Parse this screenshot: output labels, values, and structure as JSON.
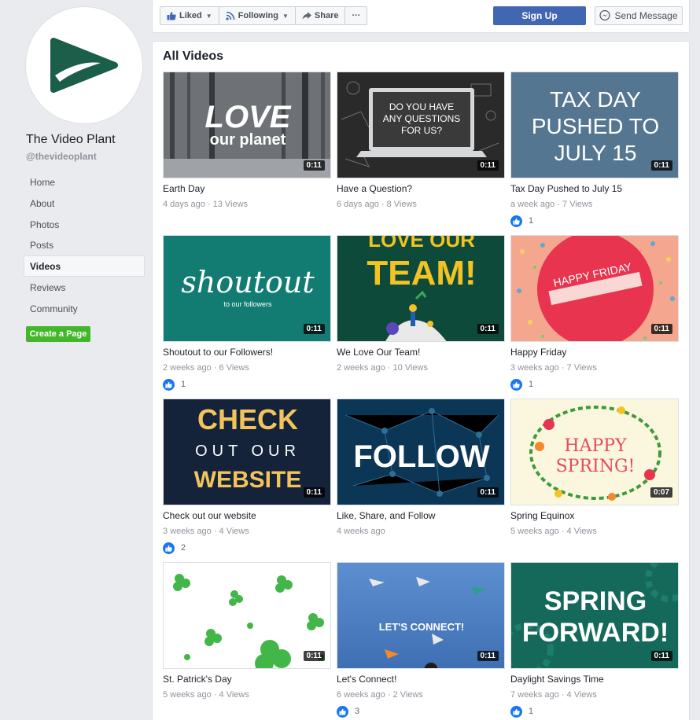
{
  "page": {
    "name": "The Video Plant",
    "handle": "@thevideoplant",
    "colors": {
      "brand_green": "#1b5e4a",
      "fb_blue": "#4267b2",
      "create_green": "#42b72a"
    }
  },
  "sidebar": {
    "items": [
      {
        "label": "Home"
      },
      {
        "label": "About"
      },
      {
        "label": "Photos"
      },
      {
        "label": "Posts"
      },
      {
        "label": "Videos",
        "active": true
      },
      {
        "label": "Reviews"
      },
      {
        "label": "Community"
      }
    ],
    "create_page_label": "Create a Page"
  },
  "action_bar": {
    "liked_label": "Liked",
    "following_label": "Following",
    "share_label": "Share",
    "more_label": "···",
    "signup_label": "Sign Up",
    "send_message_label": "Send Message"
  },
  "videos_section": {
    "title": "All Videos",
    "items": [
      {
        "title": "Earth Day",
        "meta": "4 days ago · 13 Views",
        "duration": "0:11",
        "likes": "",
        "thumb_text": [
          "LOVE",
          "our planet"
        ],
        "thumb_icon": "forest-scene"
      },
      {
        "title": "Have a Question?",
        "meta": "6 days ago · 8 Views",
        "duration": "0:11",
        "likes": "",
        "thumb_text": [
          "DO YOU HAVE",
          "ANY QUESTIONS",
          "FOR US?"
        ],
        "thumb_icon": "laptop-chalkboard"
      },
      {
        "title": "Tax Day Pushed to July 15",
        "meta": "a week ago · 7 Views",
        "duration": "0:11",
        "likes": "1",
        "thumb_text": [
          "TAX DAY",
          "PUSHED TO",
          "JULY 15"
        ],
        "thumb_icon": "none"
      },
      {
        "title": "Shoutout to our Followers!",
        "meta": "2 weeks ago · 6 Views",
        "duration": "0:11",
        "likes": "1",
        "thumb_text": [
          "shoutout",
          "to our followers"
        ],
        "thumb_icon": "none"
      },
      {
        "title": "We Love Our Team!",
        "meta": "2 weeks ago · 10 Views",
        "duration": "0:11",
        "likes": "",
        "thumb_text": [
          "LOVE OUR",
          "TEAM!"
        ],
        "thumb_icon": "team-illustration"
      },
      {
        "title": "Happy Friday",
        "meta": "3 weeks ago · 7 Views",
        "duration": "0:11",
        "likes": "1",
        "thumb_text": [
          "HAPPY FRIDAY"
        ],
        "thumb_icon": "confetti-circle"
      },
      {
        "title": "Check out our website",
        "meta": "3 weeks ago · 4 Views",
        "duration": "0:11",
        "likes": "2",
        "thumb_text": [
          "CHECK",
          "OUT OUR",
          "WEBSITE"
        ],
        "thumb_icon": "none"
      },
      {
        "title": "Like, Share, and Follow",
        "meta": "4 weeks ago",
        "duration": "0:11",
        "likes": "",
        "thumb_text": [
          "FOLLOW"
        ],
        "thumb_icon": "network-nodes"
      },
      {
        "title": "Spring Equinox",
        "meta": "5 weeks ago · 4 Views",
        "duration": "0:07",
        "likes": "",
        "thumb_text": [
          "HAPPY",
          "SPRING!"
        ],
        "thumb_icon": "flower-wreath"
      },
      {
        "title": "St. Patrick's Day",
        "meta": "5 weeks ago · 4 Views",
        "duration": "0:11",
        "likes": "",
        "thumb_text": [],
        "thumb_icon": "shamrocks"
      },
      {
        "title": "Let's Connect!",
        "meta": "6 weeks ago · 2 Views",
        "duration": "0:11",
        "likes": "3",
        "thumb_text": [
          "LET'S CONNECT!"
        ],
        "thumb_icon": "paper-planes"
      },
      {
        "title": "Daylight Savings Time",
        "meta": "7 weeks ago · 4 Views",
        "duration": "0:11",
        "likes": "1",
        "thumb_text": [
          "SPRING",
          "FORWARD!"
        ],
        "thumb_icon": "gears"
      }
    ]
  }
}
